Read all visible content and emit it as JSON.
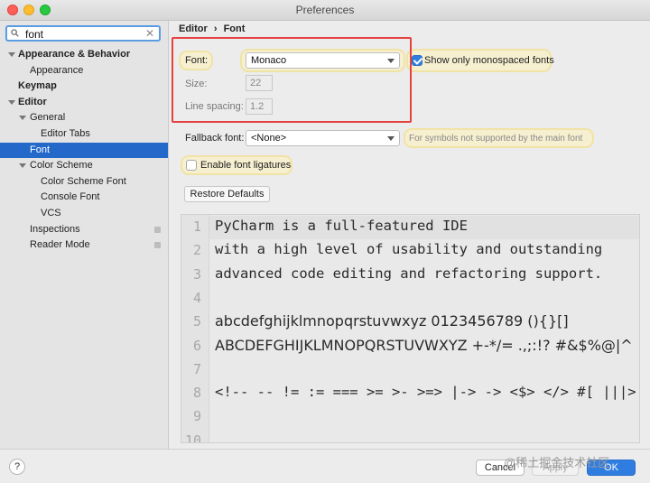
{
  "window": {
    "title": "Preferences"
  },
  "search": {
    "value": "font"
  },
  "tree": [
    {
      "label": "Appearance & Behavior",
      "bold": true,
      "expanded": true,
      "indent": 0
    },
    {
      "label": "Appearance",
      "bold": false,
      "indent": 1
    },
    {
      "label": "Keymap",
      "bold": true,
      "indent": 0
    },
    {
      "label": "Editor",
      "bold": true,
      "expanded": true,
      "indent": 0
    },
    {
      "label": "General",
      "bold": false,
      "expanded": true,
      "indent": 1
    },
    {
      "label": "Editor Tabs",
      "bold": false,
      "indent": 2
    },
    {
      "label": "Font",
      "bold": false,
      "indent": 1,
      "selected": true
    },
    {
      "label": "Color Scheme",
      "bold": false,
      "expanded": true,
      "indent": 1
    },
    {
      "label": "Color Scheme Font",
      "bold": false,
      "indent": 2
    },
    {
      "label": "Console Font",
      "bold": false,
      "indent": 2
    },
    {
      "label": "VCS",
      "bold": false,
      "indent": 2
    },
    {
      "label": "Inspections",
      "bold": false,
      "indent": 1,
      "badge": true
    },
    {
      "label": "Reader Mode",
      "bold": false,
      "indent": 1,
      "badge": true
    }
  ],
  "breadcrumb": {
    "parent": "Editor",
    "sep": "›",
    "current": "Font"
  },
  "font": {
    "label": "Font:",
    "value": "Monaco"
  },
  "monospaced": {
    "label": "Show only monospaced fonts",
    "checked": true
  },
  "size": {
    "label": "Size:",
    "value": "22"
  },
  "line_spacing": {
    "label": "Line spacing:",
    "value": "1.2"
  },
  "fallback": {
    "label": "Fallback font:",
    "value": "<None>",
    "hint": "For symbols not supported by the main font"
  },
  "ligatures": {
    "label": "Enable font ligatures",
    "checked": false
  },
  "restore_label": "Restore Defaults",
  "preview": {
    "lines": [
      {
        "num": "1",
        "text": "PyCharm is a full-featured IDE",
        "prop": false
      },
      {
        "num": "2",
        "text": "with a high level of usability and outstanding",
        "prop": false
      },
      {
        "num": "3",
        "text": "advanced code editing and refactoring support.",
        "prop": false
      },
      {
        "num": "4",
        "text": "",
        "prop": false
      },
      {
        "num": "5",
        "text": "abcdefghijklmnopqrstuvwxyz 0123456789 (){}[]",
        "prop": true
      },
      {
        "num": "6",
        "text": "ABCDEFGHIJKLMNOPQRSTUVWXYZ +-*/= .,;:!? #&$%@|^",
        "prop": true
      },
      {
        "num": "7",
        "text": "",
        "prop": false
      },
      {
        "num": "8",
        "text": "<!-- -- != := === >= >- >=> |-> -> <$> </> #[ |||> |= ~@",
        "prop": false
      },
      {
        "num": "9",
        "text": "",
        "prop": false
      },
      {
        "num": "10",
        "text": "",
        "prop": false
      }
    ]
  },
  "buttons": {
    "help": "?",
    "cancel": "Cancel",
    "apply": "Apply",
    "ok": "OK"
  },
  "watermark": "@稀土掘金技术社区",
  "colors": {
    "accent": "#2468c9",
    "highlight_border": "#e54141",
    "ok_button": "#2f7de1"
  }
}
